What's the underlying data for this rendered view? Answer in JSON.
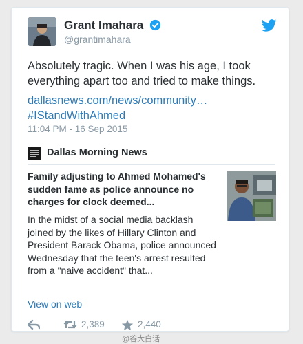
{
  "tweet": {
    "author_name": "Grant Imahara",
    "handle": "@grantimahara",
    "text": "Absolutely tragic. When I was his age, I took everything apart too and tried to make things.",
    "link": "dallasnews.com/news/community…",
    "hashtag": "#IStandWithAhmed",
    "timestamp": "11:04 PM - 16 Sep 2015",
    "icons": [
      "verified-badge-icon",
      "twitter-bird-icon"
    ]
  },
  "card": {
    "source": "Dallas Morning News",
    "headline": "Family adjusting to Ahmed Mohamed's sudden fame as police announce no charges for clock deemed...",
    "summary": "In the midst of a social media backlash joined by the likes of Hillary Clinton and President Barack Obama, police announced Wednesday that the teen's arrest resulted from a \"naive accident\" that...",
    "view_label": "View on web"
  },
  "actions": {
    "retweets": "2,389",
    "likes": "2,440",
    "icons": [
      "reply-icon",
      "retweet-icon",
      "star-icon"
    ]
  },
  "watermark": "@谷大白话",
  "colors": {
    "link": "#2b7bb9",
    "verified": "#1da1f2",
    "muted": "#8899a6"
  }
}
